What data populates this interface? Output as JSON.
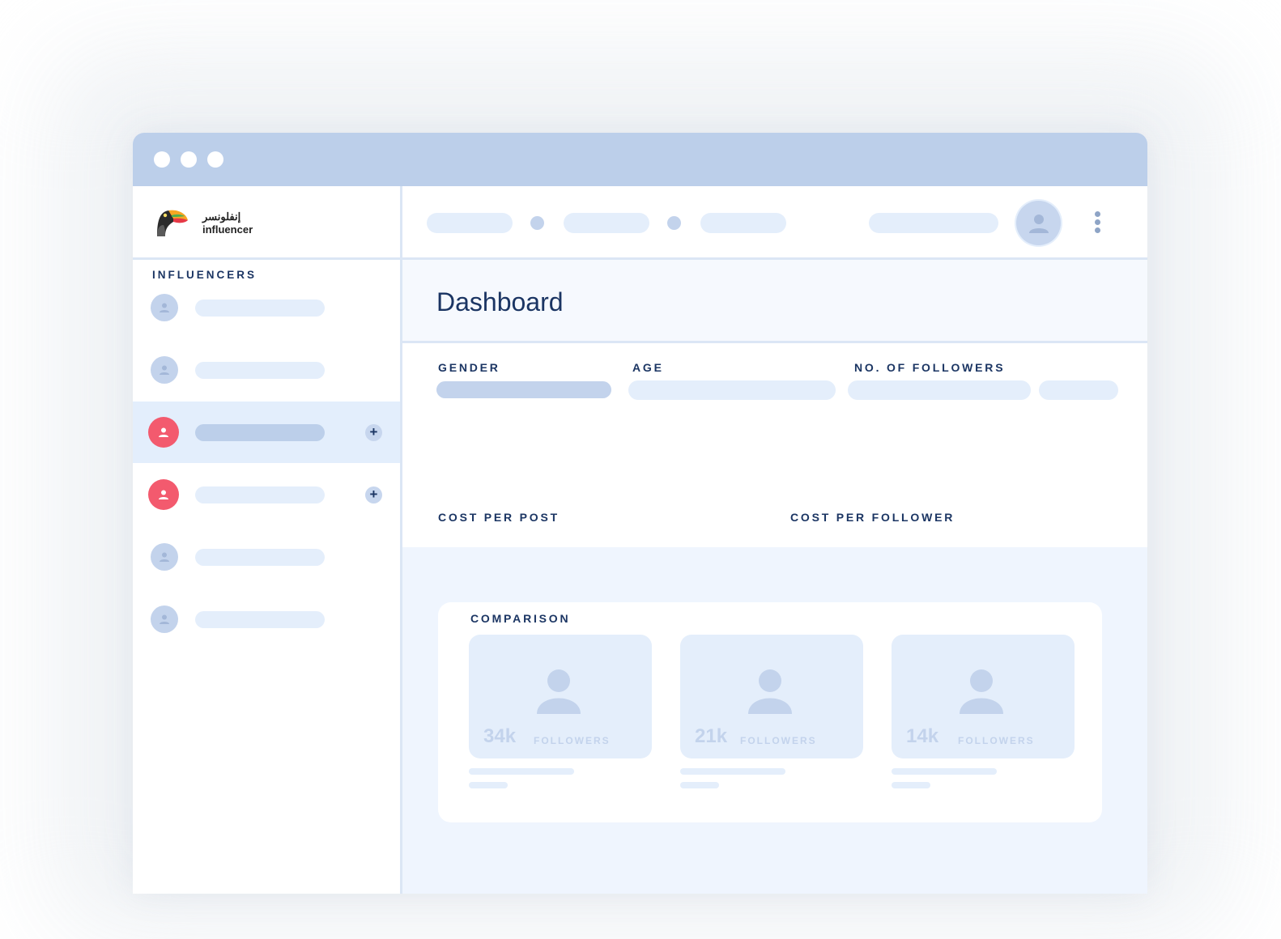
{
  "app": {
    "logo_arabic": "إنفلونسر",
    "logo_english": "influencer"
  },
  "sidebar": {
    "section_title": "INFLUENCERS",
    "items": [
      {
        "avatar": "user-icon",
        "active": false,
        "addable": false
      },
      {
        "avatar": "user-icon",
        "active": false,
        "addable": false
      },
      {
        "avatar": "user-icon",
        "active": true,
        "addable": true
      },
      {
        "avatar": "user-icon",
        "active": false,
        "addable": true
      },
      {
        "avatar": "user-icon",
        "active": false,
        "addable": false
      },
      {
        "avatar": "user-icon",
        "active": false,
        "addable": false
      }
    ],
    "add_label": "+"
  },
  "header": {
    "title": "Dashboard"
  },
  "filters": {
    "gender_label": "GENDER",
    "age_label": "AGE",
    "followers_label": "NO. OF FOLLOWERS",
    "cost_per_post_label": "COST PER POST",
    "cost_per_follower_label": "COST PER FOLLOWER"
  },
  "comparison": {
    "title": "COMPARISON",
    "cards": [
      {
        "value": "34k",
        "unit": "FOLLOWERS"
      },
      {
        "value": "21k",
        "unit": "FOLLOWERS"
      },
      {
        "value": "14k",
        "unit": "FOLLOWERS"
      }
    ]
  },
  "colors": {
    "titlebar": "#bccfea",
    "accent_navy": "#1b3563",
    "placeholder": "#e4eefb",
    "active_avatar": "#f35a6e"
  }
}
